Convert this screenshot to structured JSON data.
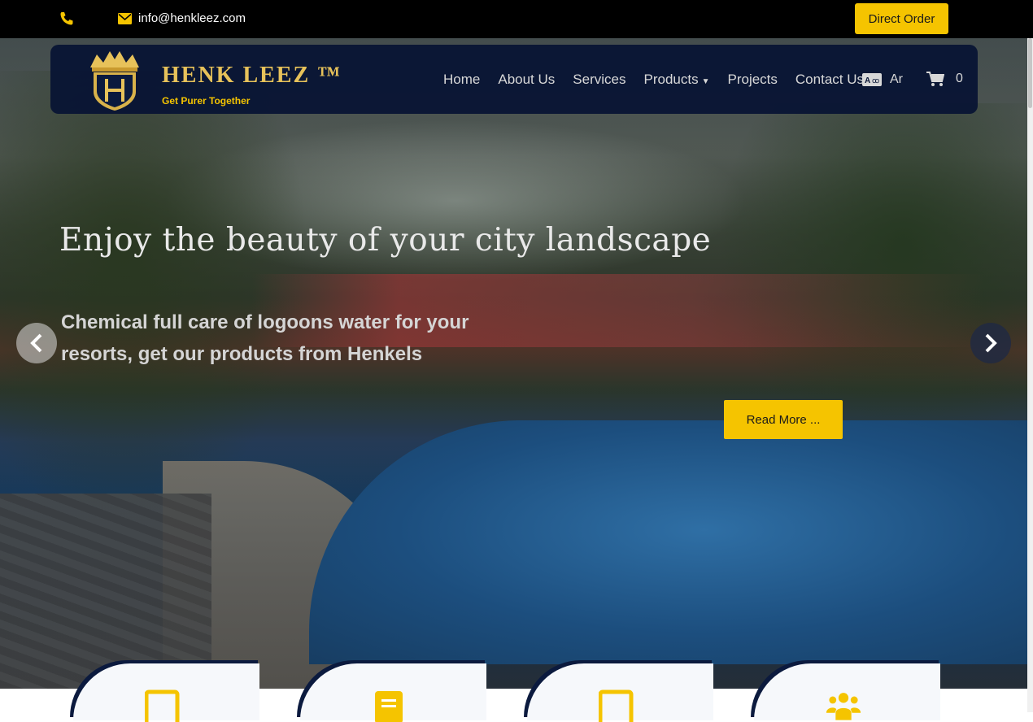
{
  "topbar": {
    "phone_icon": "phone-icon",
    "mail_icon": "envelope-icon",
    "email": "info@henkleez.com",
    "direct_order": "Direct Order"
  },
  "brand": {
    "logo": "crown-shield-logo",
    "name": "HENK LEEZ ™",
    "tagline": "Get Purer Together"
  },
  "nav": {
    "items": [
      {
        "label": "Home"
      },
      {
        "label": "About Us"
      },
      {
        "label": "Services"
      },
      {
        "label": "Products",
        "has_dropdown": true
      },
      {
        "label": "Projects"
      },
      {
        "label": "Contact Us"
      }
    ],
    "language": "Ar",
    "language_icon": "translate-icon",
    "cart_icon": "shopping-cart-icon",
    "cart_count": "0"
  },
  "hero": {
    "title": "Enjoy the beauty of your city landscape",
    "subtitle": "Chemical full care of logoons water for your resorts, get our products from Henkels",
    "button": "Read More ..."
  },
  "carousel": {
    "prev_icon": "chevron-left-icon",
    "next_icon": "chevron-right-icon"
  },
  "feature_cards": [
    {
      "icon": "mobile-icon"
    },
    {
      "icon": "document-icon"
    },
    {
      "icon": "tablet-icon"
    },
    {
      "icon": "users-icon"
    }
  ],
  "colors": {
    "accent": "#f5c400",
    "navbar": "#081434",
    "topbar": "#000000",
    "brand_gold": "#e7c25a"
  }
}
